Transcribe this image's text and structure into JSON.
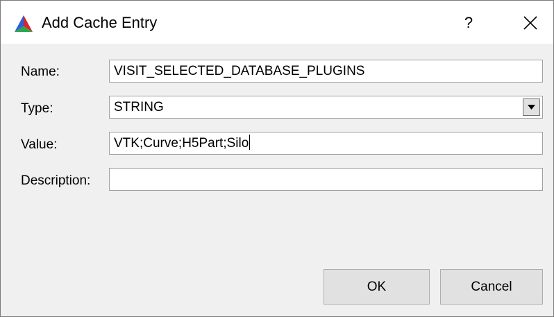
{
  "window": {
    "title": "Add Cache Entry",
    "help_label": "?"
  },
  "form": {
    "name": {
      "label": "Name:",
      "value": "VISIT_SELECTED_DATABASE_PLUGINS"
    },
    "type": {
      "label": "Type:",
      "value": "STRING"
    },
    "value": {
      "label": "Value:",
      "value": "VTK;Curve;H5Part;Silo"
    },
    "description": {
      "label": "Description:",
      "value": ""
    }
  },
  "buttons": {
    "ok": "OK",
    "cancel": "Cancel"
  },
  "icons": {
    "app": "cmake-triangle-icon",
    "close": "close-icon",
    "dropdown": "chevron-down-icon"
  }
}
